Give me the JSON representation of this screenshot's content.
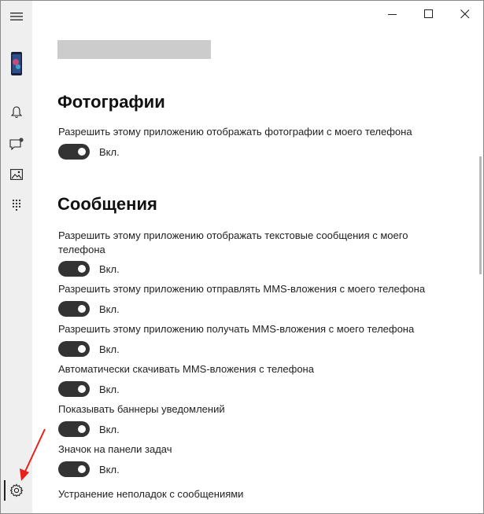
{
  "window": {
    "controls": {
      "minimize_icon": "minimize-icon",
      "maximize_icon": "maximize-icon",
      "close_icon": "close-icon"
    }
  },
  "sidebar": {
    "items": [
      "hamburger-menu-icon",
      "phone-thumbnail",
      "notifications-bell-icon",
      "messages-icon",
      "photos-icon",
      "dialpad-icon",
      "settings-gear-icon"
    ],
    "badge_color": "#444444"
  },
  "photos_section": {
    "title": "Фотографии",
    "settings": [
      {
        "label": "Разрешить этому приложению отображать фотографии с моего телефона",
        "toggle": "Вкл."
      }
    ]
  },
  "messages_section": {
    "title": "Сообщения",
    "settings": [
      {
        "label": "Разрешить этому приложению отображать текстовые сообщения с моего телефона",
        "toggle": "Вкл."
      },
      {
        "label": "Разрешить этому приложению отправлять MMS-вложения с моего телефона",
        "toggle": "Вкл."
      },
      {
        "label": "Разрешить этому приложению получать MMS-вложения с моего телефона",
        "toggle": "Вкл."
      },
      {
        "label": "Автоматически скачивать MMS-вложения с телефона",
        "toggle": "Вкл."
      },
      {
        "label": "Показывать баннеры уведомлений",
        "toggle": "Вкл."
      },
      {
        "label": "Значок на панели задач",
        "toggle": "Вкл."
      }
    ],
    "troubleshoot_link": "Устранение неполадок с сообщениями"
  },
  "colors": {
    "toggle_on": "#333333",
    "annotation_arrow": "#e8201a",
    "sidebar_bg": "#efefef"
  }
}
